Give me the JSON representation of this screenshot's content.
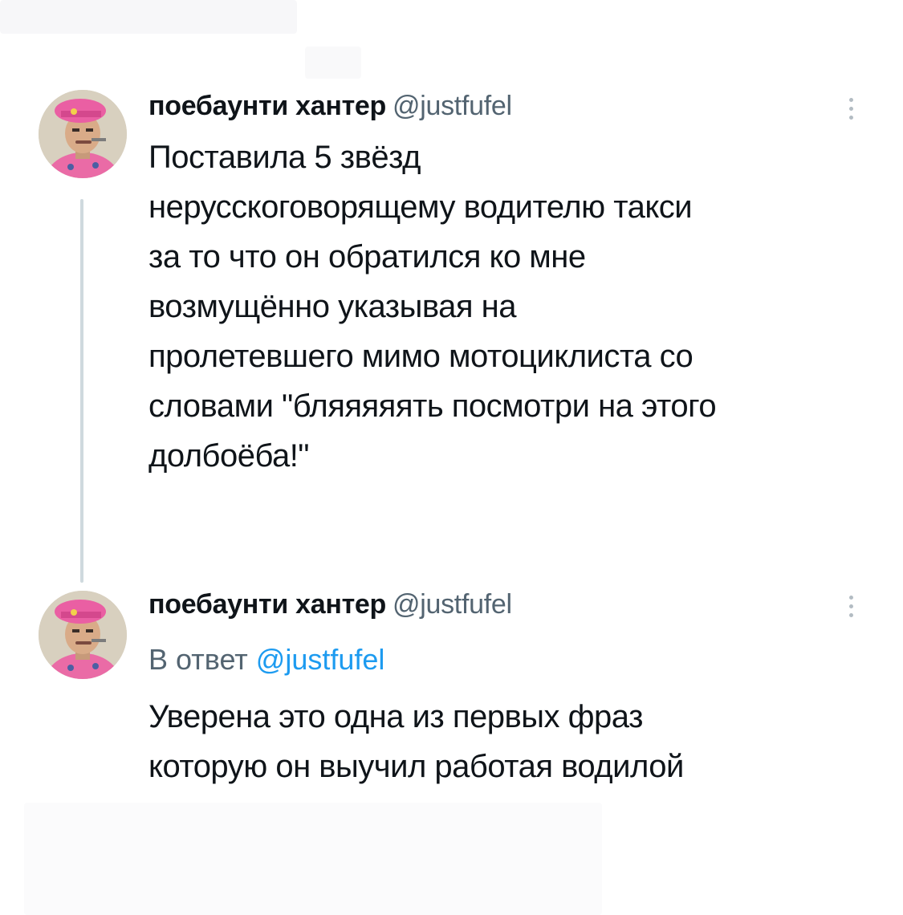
{
  "tweets": [
    {
      "author": {
        "display_name": "поебаунти хантер",
        "handle": "@justfufel",
        "avatar_icon": "avatar-pink-beret-icon"
      },
      "more_icon": "vertical-ellipsis-icon",
      "text_lines": [
        "Поставила 5 звёзд",
        "нерусскоговорящему водителю такси",
        "за то что он обратился ко мне",
        "возмущённо указывая на",
        "пролетевшего мимо мотоциклиста со",
        "словами \"бляяяяять посмотри на этого",
        "долбоёба!\""
      ]
    },
    {
      "author": {
        "display_name": "поебаунти хантер",
        "handle": "@justfufel",
        "avatar_icon": "avatar-pink-beret-icon"
      },
      "more_icon": "vertical-ellipsis-icon",
      "reply_to": {
        "prefix": "В ответ",
        "mention": "@justfufel"
      },
      "text_lines": [
        "Уверена это одна из первых фраз",
        "которую он выучил работая водилой"
      ]
    }
  ],
  "colors": {
    "text": "#0f1419",
    "secondary": "#536471",
    "link": "#1d9bf0",
    "thread_line": "#cfd9de",
    "beret": "#e86aa8"
  }
}
